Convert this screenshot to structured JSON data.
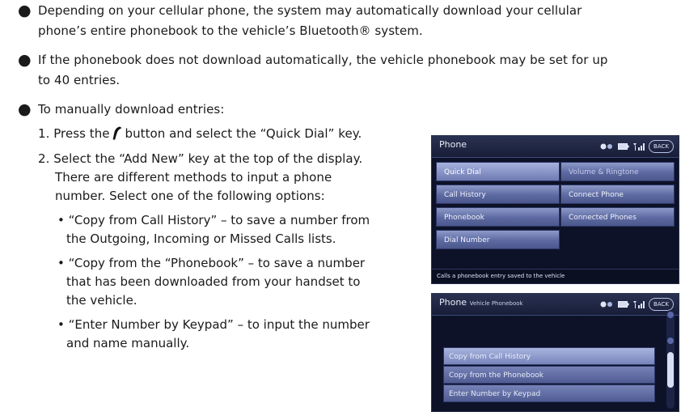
{
  "document": {
    "bullet_glyph": "●",
    "paragraphs": [
      {
        "lines": [
          "Depending on your cellular phone, the system may automatically download your cellular",
          "phone’s entire phonebook to the vehicle’s Bluetooth® system."
        ]
      },
      {
        "lines": [
          "If the phonebook does not download automatically, the vehicle phonebook may be set for up",
          "to 40 entries."
        ]
      },
      {
        "lines": [
          "To manually download entries:"
        ]
      }
    ],
    "step1": {
      "before_icon": "1. Press the",
      "icon": "phone-handset-icon",
      "after_icon": "button and select the “Quick Dial” key."
    },
    "step2_lines": [
      "2. Select the “Add New” key at the top of the display.",
      "There are different methods to input a phone",
      "number. Select one of the following options:"
    ],
    "options": [
      {
        "lines": [
          "• “Copy from Call History” – to save a number from",
          "the Outgoing, Incoming or Missed Calls lists."
        ]
      },
      {
        "lines": [
          "• “Copy from the “Phonebook” – to save a number",
          "that has been downloaded from your handset to",
          "the vehicle."
        ]
      },
      {
        "lines": [
          "• “Enter Number by Keypad” – to input the number",
          "and name manually."
        ]
      }
    ]
  },
  "screen1": {
    "title": "Phone",
    "back_label": "BACK",
    "left_buttons": [
      "Quick Dial",
      "Call History",
      "Phonebook",
      "Dial Number"
    ],
    "right_buttons": [
      "Volume & Ringtone",
      "Connect Phone",
      "Connected Phones"
    ],
    "footer": "Calls a phonebook entry saved to the vehicle"
  },
  "screen2": {
    "title": "Phone",
    "subtitle": "Vehicle Phonebook",
    "back_label": "BACK",
    "items": [
      "Copy from Call History",
      "Copy from the Phonebook",
      "Enter Number by Keypad"
    ]
  },
  "colors": {
    "text": "#1a1a1a",
    "screen_bg": "#0d1228",
    "button": "#6e7bb3"
  }
}
